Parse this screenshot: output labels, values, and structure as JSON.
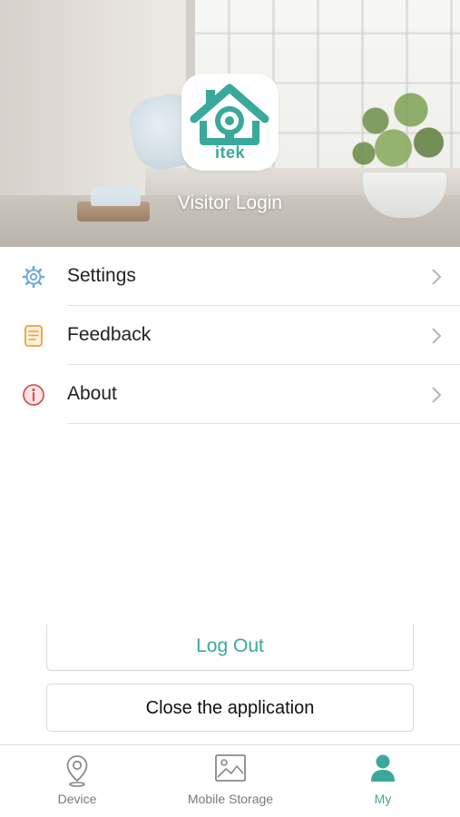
{
  "header": {
    "brand": "itek",
    "visitor_login": "Visitor Login"
  },
  "menu": {
    "items": [
      {
        "label": "Settings",
        "icon": "gear-icon"
      },
      {
        "label": "Feedback",
        "icon": "notepad-icon"
      },
      {
        "label": "About",
        "icon": "info-icon"
      }
    ]
  },
  "actions": {
    "logout": "Log Out",
    "close": "Close the application"
  },
  "tabbar": {
    "tabs": [
      {
        "label": "Device",
        "icon": "location-pin-icon",
        "active": false
      },
      {
        "label": "Mobile Storage",
        "icon": "image-icon",
        "active": false
      },
      {
        "label": "My",
        "icon": "person-icon",
        "active": true
      }
    ]
  },
  "colors": {
    "accent": "#3aa89c",
    "inactive": "#7a7a7a",
    "settings_icon": "#6aa9dc",
    "feedback_icon": "#e8a23c",
    "about_icon": "#d9534f"
  }
}
